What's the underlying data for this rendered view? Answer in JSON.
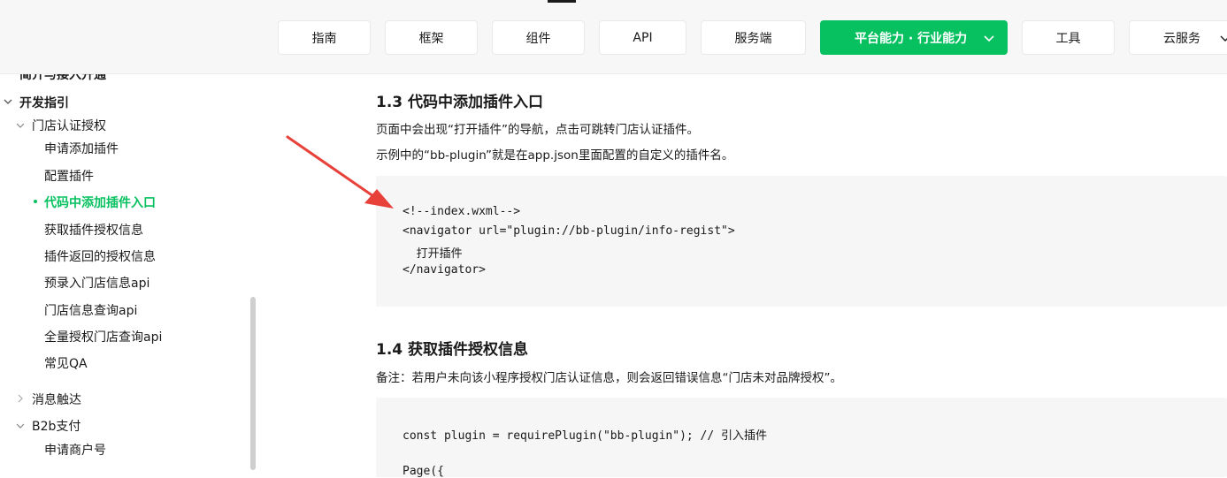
{
  "nav": {
    "tabs": [
      {
        "label": "指南"
      },
      {
        "label": "框架"
      },
      {
        "label": "组件"
      },
      {
        "label": "API"
      },
      {
        "label": "服务端"
      },
      {
        "label": "平台能力 · 行业能力"
      },
      {
        "label": "工具"
      },
      {
        "label": "云服务"
      }
    ],
    "accent": "#07c160"
  },
  "sidebar": {
    "cut_item": "简介与接入开通",
    "dev_guide": "开发指引",
    "store_auth": "门店认证授权",
    "items": [
      "申请添加插件",
      "配置插件",
      "代码中添加插件入口",
      "获取插件授权信息",
      "插件返回的授权信息",
      "预录入门店信息api",
      "门店信息查询api",
      "全量授权门店查询api",
      "常见QA"
    ],
    "msg_reach": "消息触达",
    "b2b_pay": "B2b支付",
    "apply_merchant": "申请商户号"
  },
  "content": {
    "h1": "1.3 代码中添加插件入口",
    "p1": "页面中会出现“打开插件”的导航，点击可跳转门店认证插件。",
    "p2": "示例中的“bb-plugin”就是在app.json里面配置的自定义的插件名。",
    "code1": [
      "<!--index.wxml-->",
      "<navigator url=\"plugin://bb-plugin/info-regist\">",
      "  打开插件",
      "</navigator>"
    ],
    "h2": "1.4 获取插件授权信息",
    "p3": "备注：若用户未向该小程序授权门店认证信息，则会返回错误信息“门店未对品牌授权”。",
    "code2": [
      "const plugin = requirePlugin(\"bb-plugin\"); // 引入插件",
      "",
      "Page({"
    ]
  }
}
